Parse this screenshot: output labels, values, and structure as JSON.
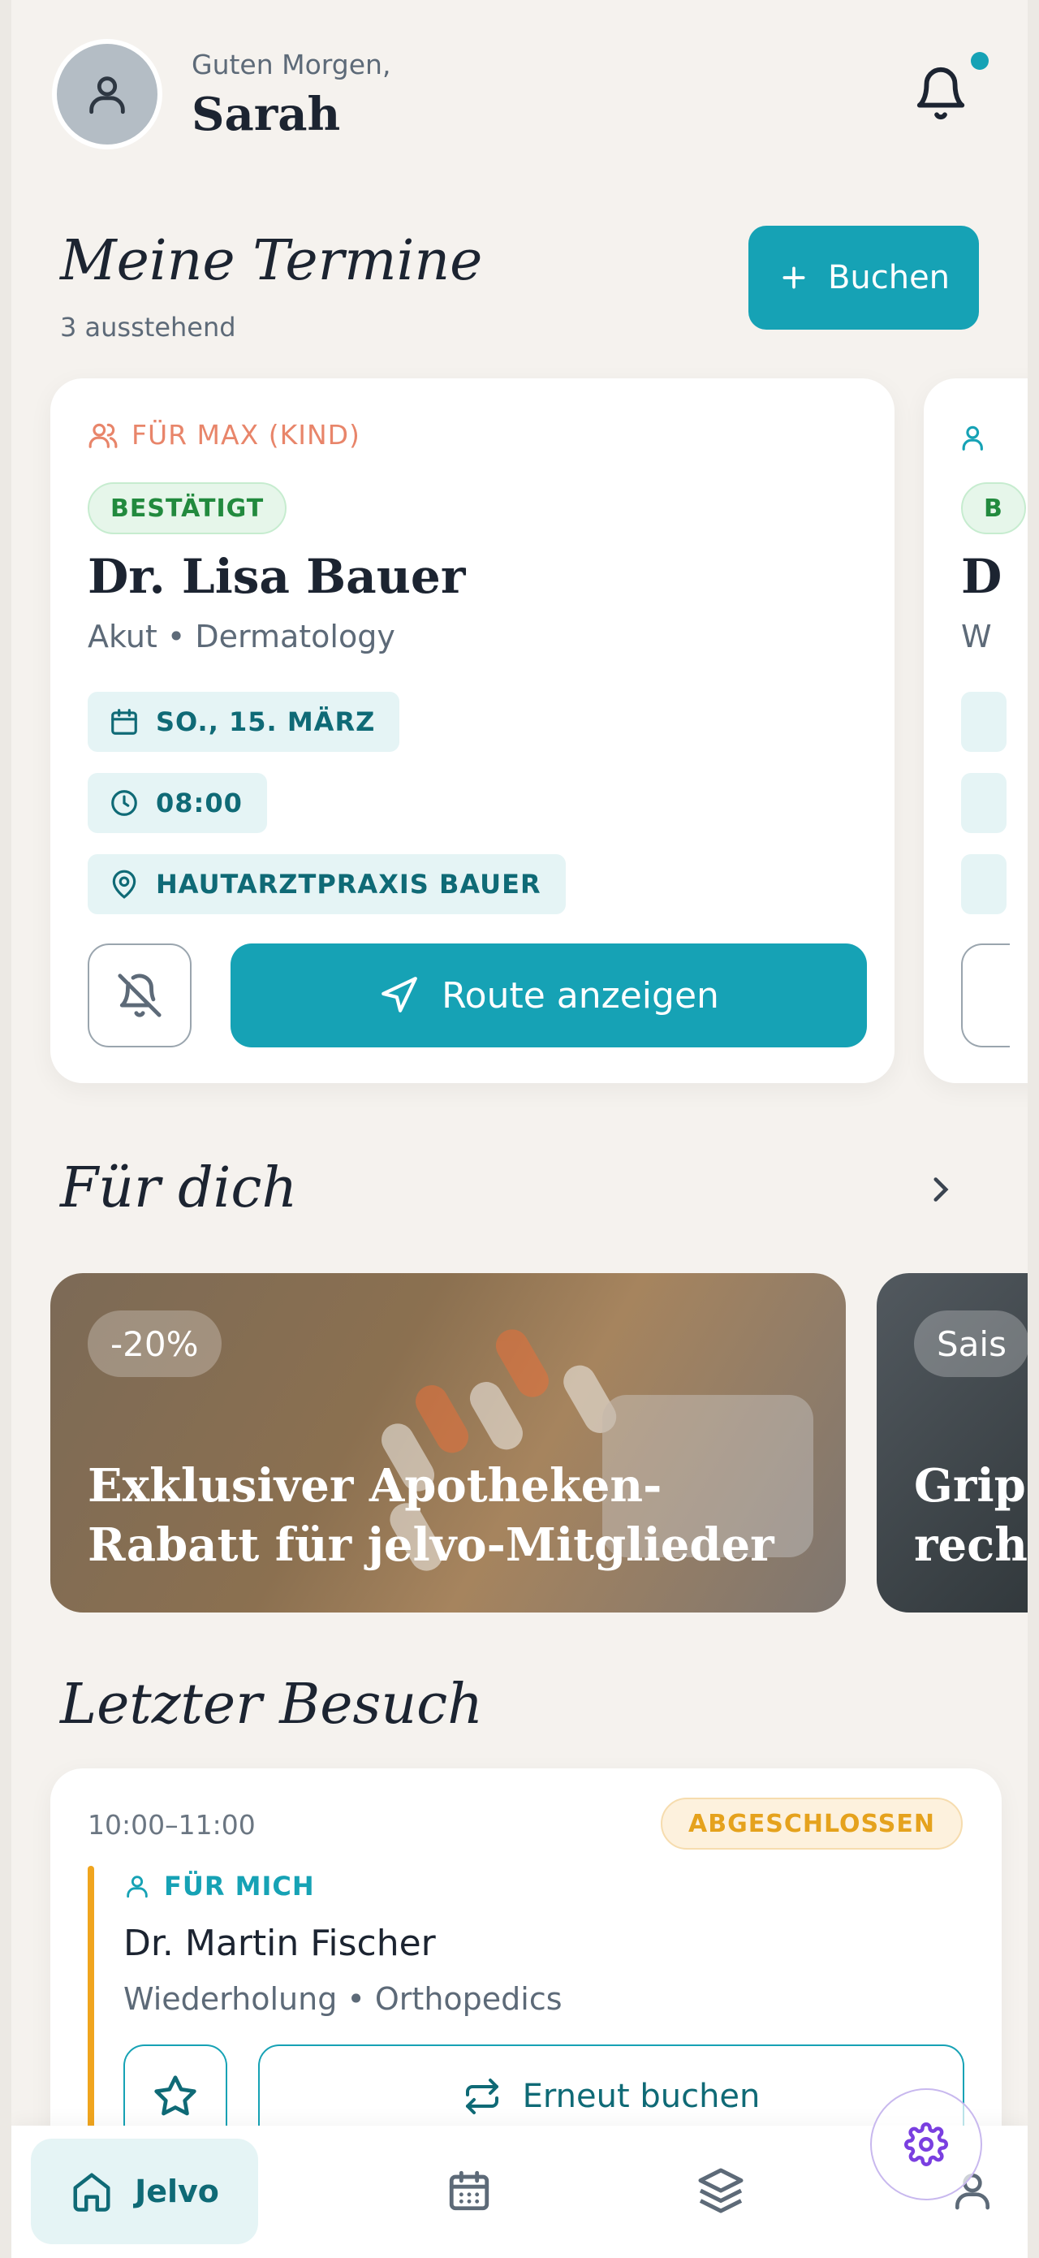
{
  "header": {
    "greeting": "Guten Morgen,",
    "name": "Sarah"
  },
  "appointments": {
    "title": "Meine Termine",
    "pending": "3 ausstehend",
    "book_label": "Buchen",
    "card": {
      "patient": "FÜR MAX (KIND)",
      "status": "BESTÄTIGT",
      "doctor": "Dr. Lisa Bauer",
      "specialty": "Akut • Dermatology",
      "date": "SO., 15. MÄRZ",
      "time": "08:00",
      "location": "HAUTARZTPRAXIS BAUER",
      "route_label": "Route anzeigen"
    },
    "peek_card": {
      "status": "B",
      "doctor": "D",
      "specialty": "W"
    }
  },
  "for_you": {
    "title": "Für dich",
    "promos": [
      {
        "badge": "-20%",
        "title": "Exklusiver Apotheken-Rabatt für jelvo-Mitglieder"
      },
      {
        "badge": "Sais",
        "title": "Grip rech"
      }
    ]
  },
  "last_visit": {
    "title": "Letzter Besuch",
    "time": "10:00–11:00",
    "status": "ABGESCHLOSSEN",
    "patient": "FÜR MICH",
    "doctor": "Dr. Martin Fischer",
    "specialty": "Wiederholung • Orthopedics",
    "rebook_label": "Erneut buchen"
  },
  "nav": {
    "home_label": "Jelvo"
  },
  "colors": {
    "primary": "#16a2b5",
    "confirmed": "#228a3e",
    "completed": "#e5a21d",
    "patient_accent": "#e8856a",
    "settings_fab": "#7a3fe0"
  },
  "icons": [
    "user-icon",
    "bell-icon",
    "plus-icon",
    "users-icon",
    "calendar-icon",
    "clock-icon",
    "map-pin-icon",
    "bell-off-icon",
    "navigation-icon",
    "chevron-right-icon",
    "star-icon",
    "repeat-icon",
    "home-icon",
    "layers-icon",
    "gear-icon"
  ]
}
